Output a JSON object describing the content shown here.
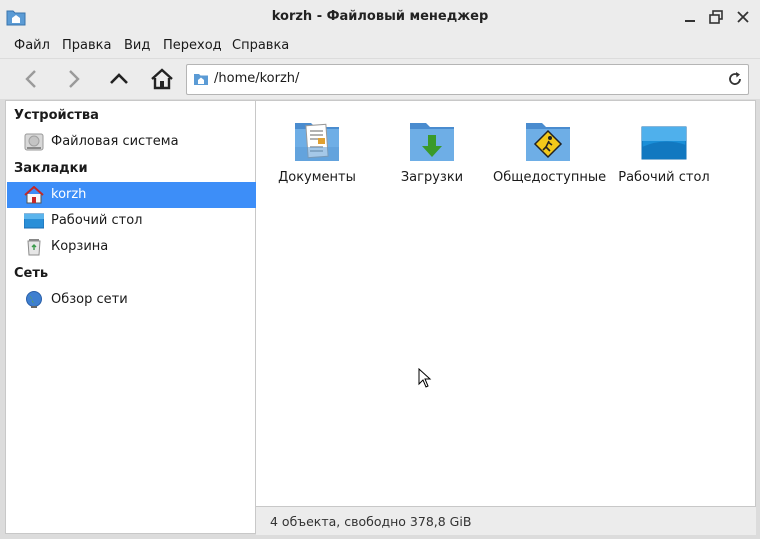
{
  "window": {
    "title": "korzh - Файловый менеджер",
    "controls": [
      "minimize",
      "maximize",
      "close"
    ]
  },
  "menu": [
    "Файл",
    "Правка",
    "Вид",
    "Переход",
    "Справка"
  ],
  "toolbar": {
    "path": "/home/korzh/"
  },
  "sidebar": {
    "sections": [
      {
        "heading": "Устройства",
        "items": [
          {
            "label": "Файловая система",
            "icon": "drive-icon"
          }
        ]
      },
      {
        "heading": "Закладки",
        "items": [
          {
            "label": "korzh",
            "icon": "home-folder-icon",
            "selected": true
          },
          {
            "label": "Рабочий стол",
            "icon": "desktop-icon"
          },
          {
            "label": "Корзина",
            "icon": "trash-icon"
          }
        ]
      },
      {
        "heading": "Сеть",
        "items": [
          {
            "label": "Обзор сети",
            "icon": "network-icon"
          }
        ]
      }
    ]
  },
  "files": [
    {
      "name": "Документы",
      "icon": "documents-folder-icon"
    },
    {
      "name": "Загрузки",
      "icon": "downloads-folder-icon"
    },
    {
      "name": "Общедоступные",
      "icon": "public-folder-icon"
    },
    {
      "name": "Рабочий стол",
      "icon": "desktop-folder-icon"
    }
  ],
  "status": "4 объекта, свободно 378,8 GiB",
  "colors": {
    "selection": "#3d8ef8",
    "folder": "#5b9bd5"
  }
}
